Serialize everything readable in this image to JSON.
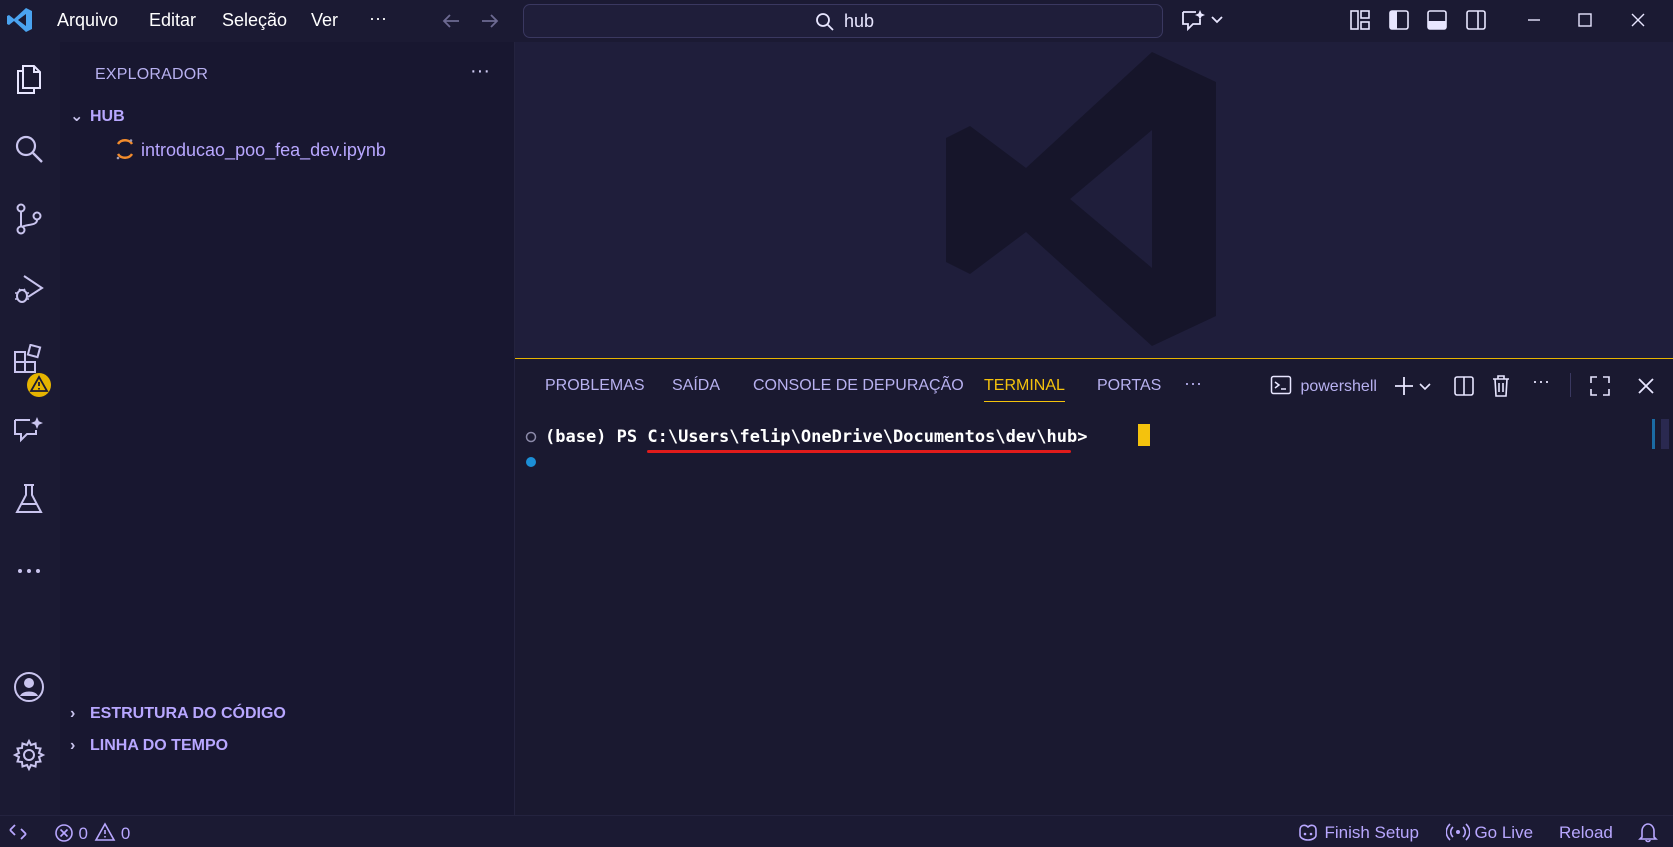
{
  "menu": {
    "file": "Arquivo",
    "edit": "Editar",
    "selection": "Seleção",
    "view": "Ver",
    "more": "···"
  },
  "search": {
    "value": "hub"
  },
  "sidebar": {
    "title": "EXPLORADOR",
    "more": "···",
    "folder": "HUB",
    "file": "introducao_poo_fea_dev.ipynb",
    "outline": "ESTRUTURA DO CÓDIGO",
    "timeline": "LINHA DO TEMPO"
  },
  "panel": {
    "tabs": [
      "PROBLEMAS",
      "SAÍDA",
      "CONSOLE DE DEPURAÇÃO",
      "TERMINAL",
      "PORTAS"
    ],
    "more": "···",
    "shell": "powershell",
    "prompt_prefix": "(base) PS ",
    "prompt_path": "C:\\Users\\felip\\OneDrive\\Documentos\\dev\\hub",
    "prompt_suffix": "> "
  },
  "status": {
    "errors": "0",
    "warnings": "0",
    "finish_setup": "Finish Setup",
    "go_live": "Go Live",
    "reload": "Reload"
  },
  "colors": {
    "accent": "#f4c20d",
    "link": "#b8a7ff",
    "underline": "#e01b1b",
    "warning_badge": "#e6b400"
  }
}
